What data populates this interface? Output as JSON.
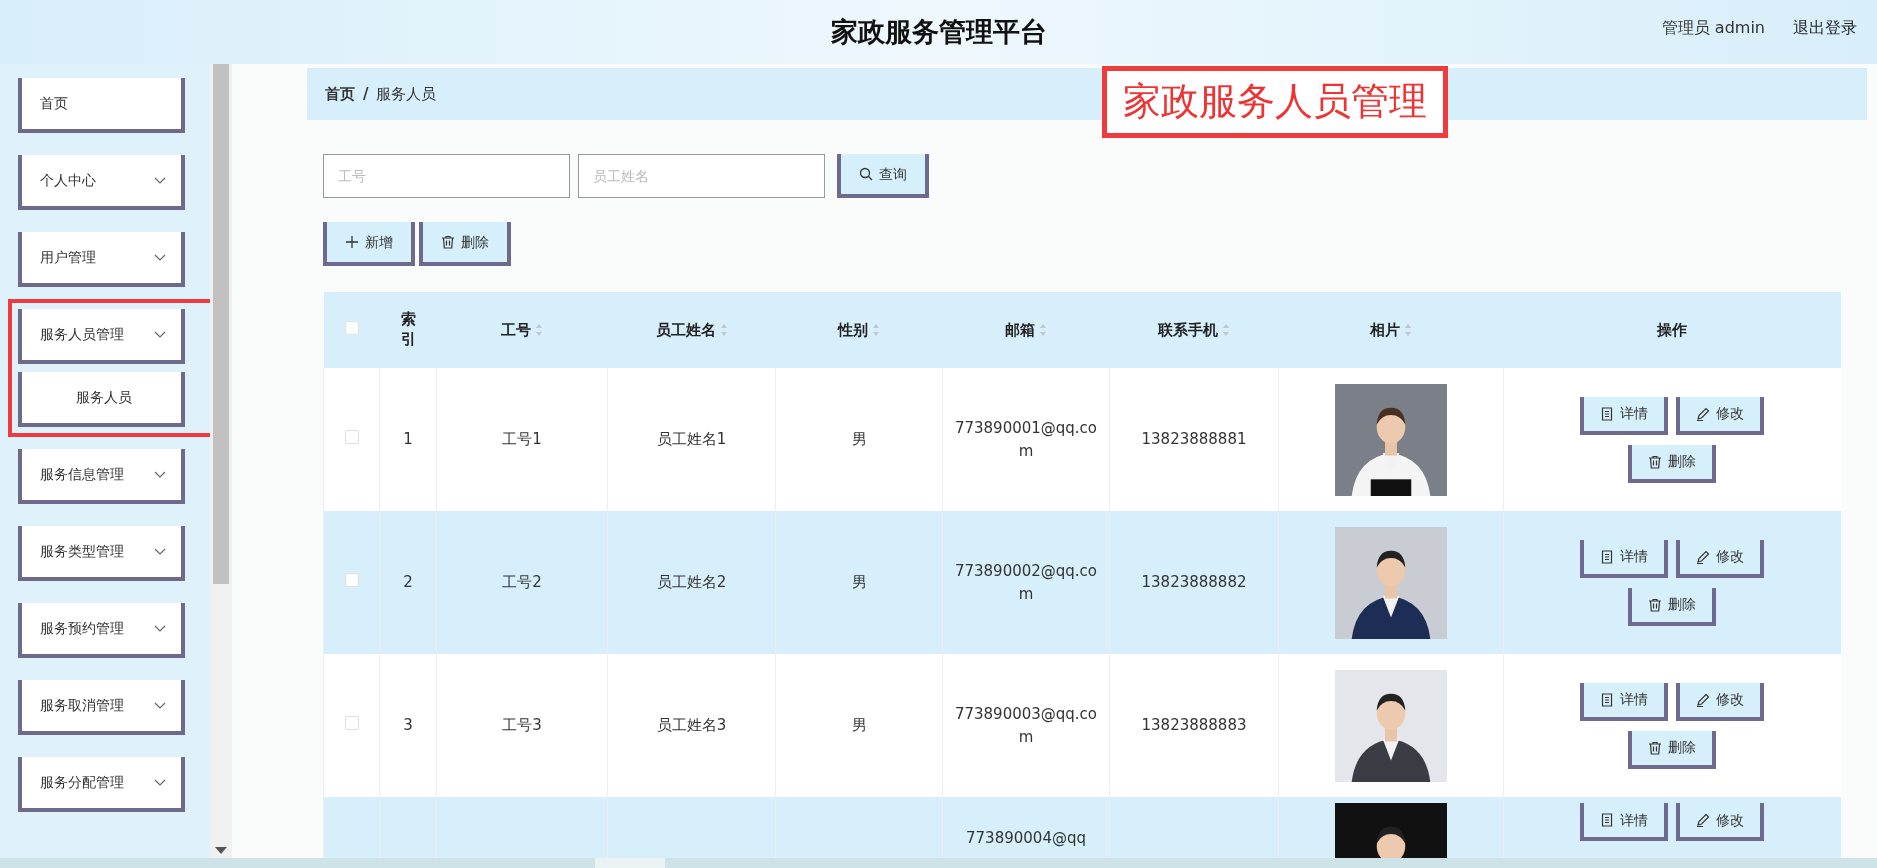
{
  "header": {
    "title": "家政服务管理平台",
    "user": "管理员 admin",
    "logout": "退出登录"
  },
  "sidebar": {
    "items": [
      {
        "label": "首页",
        "kind": "link"
      },
      {
        "label": "个人中心",
        "kind": "menu"
      },
      {
        "label": "用户管理",
        "kind": "menu"
      },
      {
        "label": "服务人员管理",
        "kind": "menu",
        "highlighted": true,
        "children": [
          {
            "label": "服务人员"
          }
        ]
      },
      {
        "label": "服务信息管理",
        "kind": "menu"
      },
      {
        "label": "服务类型管理",
        "kind": "menu"
      },
      {
        "label": "服务预约管理",
        "kind": "menu"
      },
      {
        "label": "服务取消管理",
        "kind": "menu"
      },
      {
        "label": "服务分配管理",
        "kind": "menu"
      }
    ]
  },
  "breadcrumb": {
    "items": [
      "首页",
      "服务人员"
    ],
    "separator": "/"
  },
  "annotation": "家政服务人员管理",
  "search": {
    "fields": [
      {
        "placeholder": "工号"
      },
      {
        "placeholder": "员工姓名"
      }
    ],
    "button": "查询"
  },
  "toolbar": [
    {
      "label": "新增",
      "kind": "add"
    },
    {
      "label": "删除",
      "kind": "delete"
    }
  ],
  "table": {
    "columns": [
      {
        "label": "索引",
        "sortable": false
      },
      {
        "label": "工号",
        "sortable": true
      },
      {
        "label": "员工姓名",
        "sortable": true
      },
      {
        "label": "性别",
        "sortable": true
      },
      {
        "label": "邮箱",
        "sortable": true
      },
      {
        "label": "联系手机",
        "sortable": true
      },
      {
        "label": "相片",
        "sortable": true
      },
      {
        "label": "操作",
        "sortable": false
      }
    ],
    "select_all": {
      "checked": false
    },
    "rows": [
      {
        "checked": false,
        "index": "1",
        "number": "工号1",
        "name": "员工姓名1",
        "gender": "男",
        "email": "773890001@qq.com",
        "phone": "13823888881",
        "photo": {
          "kind": "picture"
        },
        "actions": [
          {
            "label": "详情",
            "kind": "detail"
          },
          {
            "label": "修改",
            "kind": "edit"
          },
          {
            "label": "删除",
            "kind": "delete"
          }
        ]
      },
      {
        "checked": false,
        "index": "2",
        "number": "工号2",
        "name": "员工姓名2",
        "gender": "男",
        "email": "773890002@qq.com",
        "phone": "13823888882",
        "photo": {
          "kind": "picture"
        },
        "actions": [
          {
            "label": "详情",
            "kind": "detail"
          },
          {
            "label": "修改",
            "kind": "edit"
          },
          {
            "label": "删除",
            "kind": "delete"
          }
        ]
      },
      {
        "checked": false,
        "index": "3",
        "number": "工号3",
        "name": "员工姓名3",
        "gender": "男",
        "email": "773890003@qq.com",
        "phone": "13823888883",
        "photo": {
          "kind": "picture"
        },
        "actions": [
          {
            "label": "详情",
            "kind": "detail"
          },
          {
            "label": "修改",
            "kind": "edit"
          },
          {
            "label": "删除",
            "kind": "delete"
          }
        ]
      },
      {
        "email": "773890004@qq",
        "photo": {
          "kind": "picture"
        },
        "actions": [
          {
            "label": "详情",
            "kind": "detail"
          },
          {
            "label": "修改",
            "kind": "edit"
          }
        ]
      }
    ]
  }
}
